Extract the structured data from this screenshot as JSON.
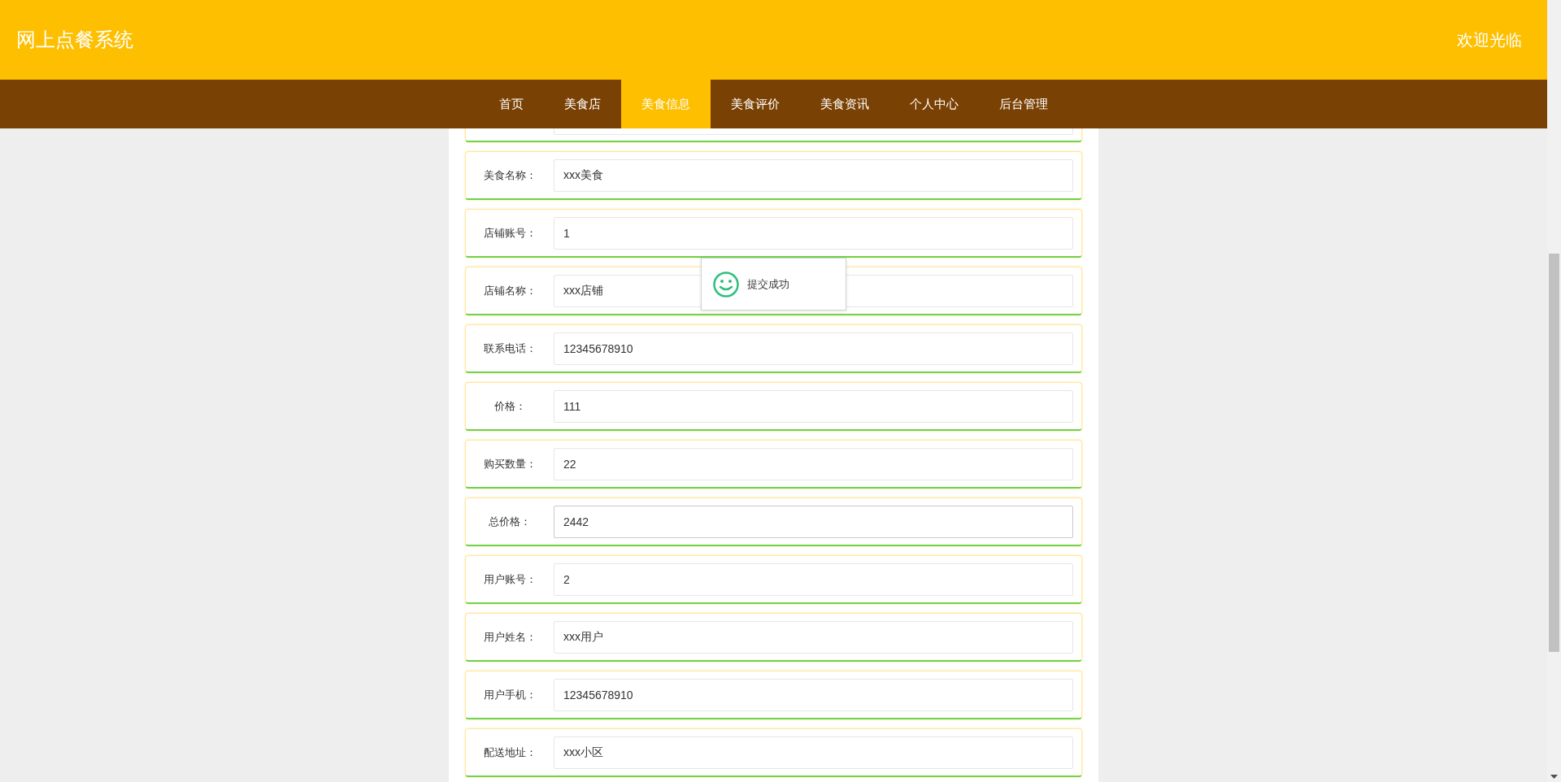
{
  "header": {
    "title": "网上点餐系统",
    "welcome": "欢迎光临"
  },
  "nav": [
    {
      "label": "首页",
      "selected": false
    },
    {
      "label": "美食店",
      "selected": false
    },
    {
      "label": "美食信息",
      "selected": true
    },
    {
      "label": "美食评价",
      "selected": false
    },
    {
      "label": "美食资讯",
      "selected": false
    },
    {
      "label": "个人中心",
      "selected": false
    },
    {
      "label": "后台管理",
      "selected": false
    }
  ],
  "form": {
    "fields": [
      {
        "label": "美食名称：",
        "value": "xxx美食",
        "focused": false
      },
      {
        "label": "店铺账号：",
        "value": "1",
        "focused": false
      },
      {
        "label": "店铺名称：",
        "value": "xxx店铺",
        "focused": false
      },
      {
        "label": "联系电话：",
        "value": "12345678910",
        "focused": false
      },
      {
        "label": "价格：",
        "value": "111",
        "focused": false
      },
      {
        "label": "购买数量：",
        "value": "22",
        "focused": false
      },
      {
        "label": "总价格：",
        "value": "2442",
        "focused": true
      },
      {
        "label": "用户账号：",
        "value": "2",
        "focused": false
      },
      {
        "label": "用户姓名：",
        "value": "xxx用户",
        "focused": false
      },
      {
        "label": "用户手机：",
        "value": "12345678910",
        "focused": false
      },
      {
        "label": "配送地址：",
        "value": "xxx小区",
        "focused": false
      }
    ]
  },
  "toast": {
    "message": "提交成功"
  }
}
